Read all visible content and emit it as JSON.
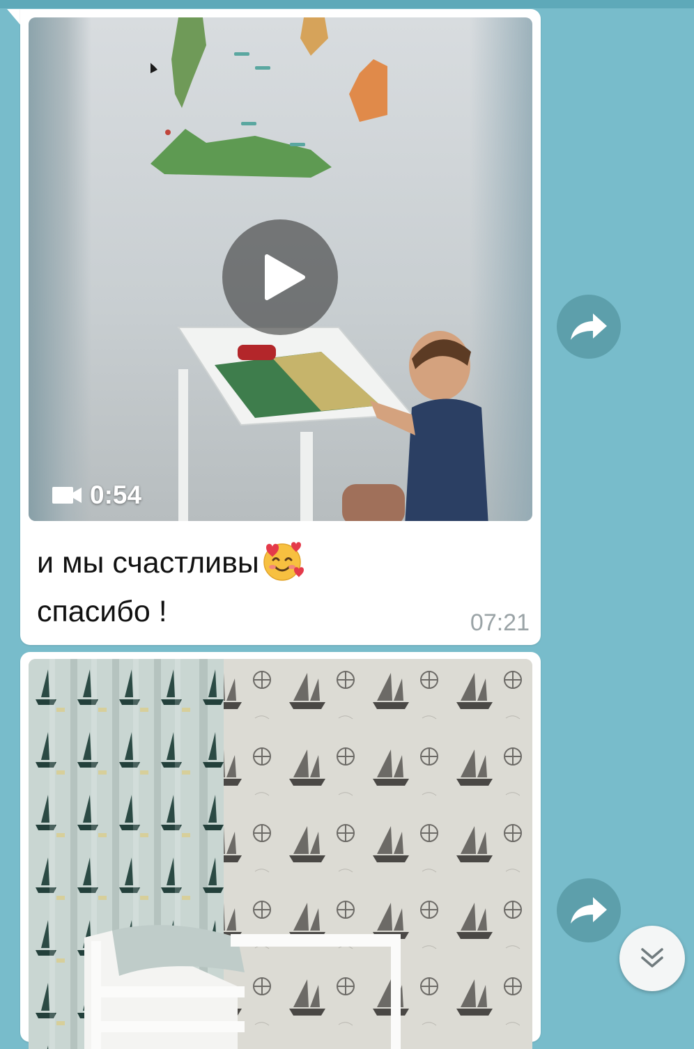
{
  "messages": [
    {
      "type": "video",
      "duration": "0:54",
      "caption_line1": "и мы счастливы",
      "caption_emoji": "smiling-face-with-hearts",
      "caption_line2": "спасибо !",
      "time": "07:21"
    },
    {
      "type": "photo"
    }
  ],
  "colors": {
    "chat_background": "#78bccb",
    "bubble": "#ffffff",
    "share_button": "#5d9fab",
    "timestamp": "#9aa3a6"
  },
  "icons": {
    "play": "play-icon",
    "video": "video-camera-icon",
    "share": "share-arrow-icon",
    "scroll_down": "double-chevron-down-icon"
  }
}
